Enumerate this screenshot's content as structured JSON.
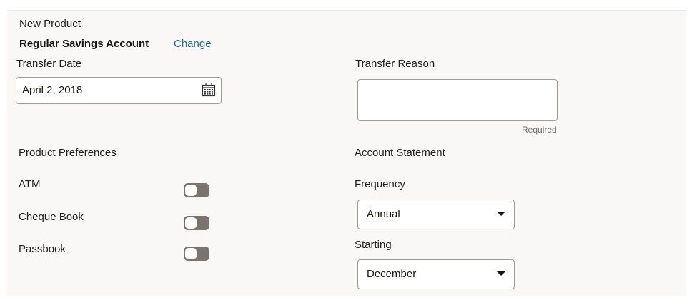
{
  "section_title": "New Product",
  "product": {
    "name": "Regular Savings Account",
    "change_label": "Change"
  },
  "transfer_date": {
    "label": "Transfer Date",
    "value": "April 2, 2018",
    "icon": "calendar-icon"
  },
  "transfer_reason": {
    "label": "Transfer Reason",
    "value": "",
    "helper": "Required"
  },
  "product_preferences": {
    "title": "Product Preferences",
    "items": [
      {
        "label": "ATM",
        "enabled": false
      },
      {
        "label": "Cheque Book",
        "enabled": false
      },
      {
        "label": "Passbook",
        "enabled": false
      }
    ]
  },
  "account_statement": {
    "title": "Account Statement",
    "frequency_label": "Frequency",
    "frequency_value": "Annual",
    "starting_label": "Starting",
    "starting_value": "December"
  }
}
